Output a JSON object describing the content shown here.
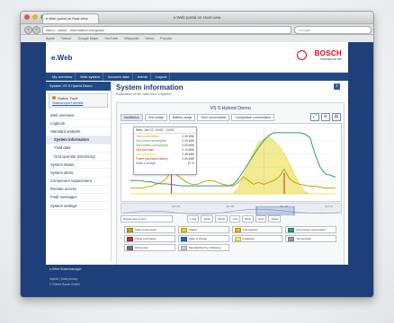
{
  "browser": {
    "title": "e.Web portal on Host view",
    "tab": "e.Web portal on Host view",
    "url": "http://...about...Information-Integrator",
    "search_placeholder": "Google",
    "bookmarks": [
      "Apple",
      "Yahoo!",
      "Google Maps",
      "YouTube",
      "Wikipedia",
      "News",
      "Popular"
    ]
  },
  "app": {
    "brand": "e.Web",
    "company": "BOSCH",
    "tagline": "Invented for life",
    "nav": [
      "My overview",
      "Web system",
      "Account data",
      "Admin",
      "Logout"
    ]
  },
  "sidebar": {
    "header": "System VS 5 Hybrid Demo",
    "status_label": "Status: Fault",
    "status_link": "Statusreport details",
    "items": [
      {
        "label": "Web overview",
        "sub": false,
        "active": false
      },
      {
        "label": "Logbook",
        "sub": false,
        "active": false
      },
      {
        "label": "Standard analysis",
        "sub": false,
        "active": false
      },
      {
        "label": "System information",
        "sub": true,
        "active": true
      },
      {
        "label": "Yield data",
        "sub": true,
        "active": false
      },
      {
        "label": "Grid operator (electricity)",
        "sub": true,
        "active": false
      },
      {
        "label": "System status",
        "sub": false,
        "active": false
      },
      {
        "label": "System alerts",
        "sub": false,
        "active": false
      },
      {
        "label": "Component replacement",
        "sub": false,
        "active": false
      },
      {
        "label": "Remote access",
        "sub": false,
        "active": false
      },
      {
        "label": "Fault messages",
        "sub": false,
        "active": false
      },
      {
        "label": "System settings",
        "sub": false,
        "active": false
      }
    ]
  },
  "content": {
    "title": "System information",
    "subtitle": "Evaluation of the data from a system",
    "help": "i"
  },
  "chart_panel": {
    "title": "VS 5 Hybrid Demo",
    "tabs": [
      "Installation",
      "Grid usage",
      "Battery usage",
      "Own consumption",
      "Comparison consumption"
    ],
    "tools": [
      "expand-icon",
      "zoom-icon",
      "print-icon"
    ],
    "tooltip": {
      "heading": "Wed, Jun 10, 10:00 - 11:00",
      "rows": [
        {
          "label": "Total consumption",
          "value": "0.30 kWh",
          "color": "#c8a400"
        },
        {
          "label": "Own direct consumption",
          "value": "0.20 kWh",
          "color": "#2e9a76"
        },
        {
          "label": "Own battery consumption",
          "value": "0.00 kWh",
          "color": "#7b8d2e"
        },
        {
          "label": "Grid purchase",
          "value": "0.10 kWh",
          "color": "#c82a2a"
        },
        {
          "label": "Own generation",
          "value": "2.30 kWh",
          "color": "#e3d200"
        },
        {
          "label": "Power purchased battery",
          "value": "0.00 kWh",
          "color": "#c82a2a"
        },
        {
          "label": "State of charge",
          "value": "57 %",
          "color": "#1f6bb8"
        }
      ]
    },
    "timeline_labels": [
      "Jun 08",
      "Jun 09",
      "Jun 10",
      "Jun 11"
    ],
    "controls": [
      "Display date & time",
      "1 day",
      "Week",
      "Month",
      "Year",
      "Back",
      "Next",
      "Today"
    ],
    "legend": [
      {
        "label": "Total consumption",
        "color": "#c8a400"
      },
      {
        "label": "Output",
        "color": "#e3d200"
      },
      {
        "label": "Grid injection",
        "color": "#f0b800"
      },
      {
        "label": "Own power consumption",
        "color": "#2e9a76"
      },
      {
        "label": "Power purchased",
        "color": "#c82a2a"
      },
      {
        "label": "State of charge",
        "color": "#1f6bb8"
      },
      {
        "label": "Irradiance",
        "color": "#f6e95c"
      },
      {
        "label": "Temperature",
        "color": "#9a9a9a"
      },
      {
        "label": "Grid power",
        "color": "#777777"
      },
      {
        "label": "Standardized by irradiance",
        "color": "#cccccc"
      }
    ]
  },
  "footer": {
    "line1": "e.Web Solarmanager",
    "line2": "Imprint | Data privacy",
    "line3": "© Robert Bosch GmbH"
  },
  "chart_data": {
    "type": "area",
    "x": [
      0,
      1,
      2,
      3,
      4,
      5,
      6,
      7,
      8,
      9,
      10,
      11,
      12,
      13,
      14,
      15,
      16,
      17,
      18,
      19,
      20,
      21,
      22,
      23,
      24,
      25,
      26,
      27,
      28,
      29,
      30,
      31,
      32,
      33,
      34,
      35,
      36,
      37,
      38,
      39,
      40
    ],
    "series": [
      {
        "name": "Output",
        "values": [
          0,
          0,
          0,
          0,
          0,
          0,
          0,
          0,
          0,
          0,
          0,
          0,
          0,
          0,
          0,
          0,
          0,
          0,
          0,
          0,
          0,
          0.3,
          0.9,
          1.6,
          2.2,
          2.7,
          2.9,
          3.0,
          2.8,
          2.5,
          2.1,
          1.6,
          1.0,
          0.5,
          0.1,
          0,
          0,
          0,
          0,
          0,
          0
        ]
      },
      {
        "name": "Total consumption",
        "values": [
          0.3,
          0.3,
          0.3,
          0.35,
          0.4,
          0.5,
          0.6,
          0.8,
          1.2,
          1.0,
          0.8,
          0.6,
          0.5,
          0.5,
          0.6,
          0.7,
          0.7,
          0.6,
          0.5,
          0.45,
          0.4,
          0.6,
          0.9,
          0.7,
          0.5,
          0.6,
          0.5,
          0.6,
          0.7,
          0.9,
          1.3,
          0.8,
          0.6,
          0.5,
          0.45,
          0.4,
          0.4,
          0.35,
          0.3,
          0.3,
          0.3
        ]
      },
      {
        "name": "State of charge",
        "values": [
          20,
          20,
          20,
          18,
          18,
          16,
          15,
          15,
          14,
          13,
          12,
          12,
          12,
          12,
          12,
          12,
          12,
          12,
          12,
          12,
          14,
          22,
          34,
          46,
          58,
          70,
          80,
          88,
          92,
          92,
          92,
          92,
          92,
          92,
          90,
          85,
          60,
          40,
          30,
          28,
          25
        ]
      }
    ],
    "ylim": [
      0,
      3.5
    ]
  }
}
